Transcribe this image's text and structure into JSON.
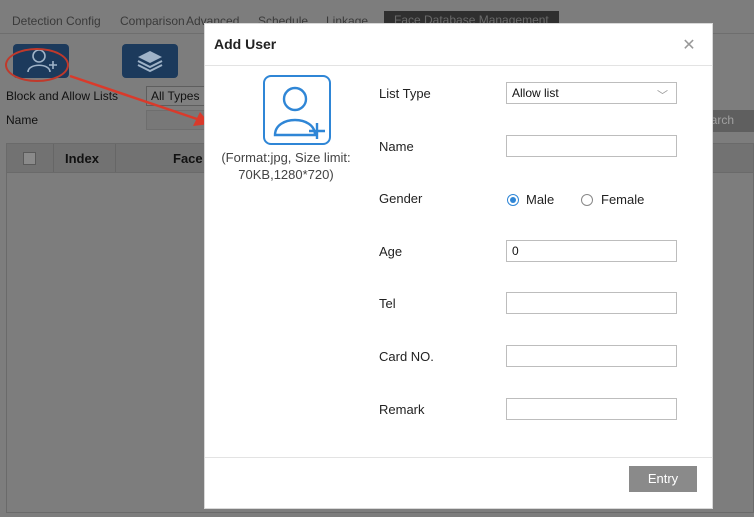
{
  "tabs": [
    "Detection Config",
    "Comparison",
    "Advanced",
    "Schedule",
    "Linkage",
    "Face Database Management"
  ],
  "toolbar": {
    "add_user_icon": "user-add-icon",
    "import_icon": "layers-icon"
  },
  "filters": {
    "list_label": "Block and Allow Lists",
    "list_value": "All Types",
    "name_label": "Name",
    "search_label": "Search"
  },
  "grid": {
    "headers": [
      "Index",
      "Face"
    ]
  },
  "modal": {
    "title": "Add User",
    "close_icon": "close-icon",
    "photo_hint": "(Format:jpg, Size limit: 70KB,1280*720)",
    "fields": {
      "list_type_label": "List Type",
      "list_type_value": "Allow list",
      "name_label": "Name",
      "name_value": "",
      "gender_label": "Gender",
      "gender_male": "Male",
      "gender_female": "Female",
      "gender_selected": "Male",
      "age_label": "Age",
      "age_value": "0",
      "tel_label": "Tel",
      "tel_value": "",
      "card_label": "Card NO.",
      "card_value": "",
      "remark_label": "Remark",
      "remark_value": ""
    },
    "entry_label": "Entry"
  },
  "colors": {
    "accent": "#2f86d6",
    "annotation": "#d93a2b",
    "button_dark": "#1c3a5c"
  }
}
